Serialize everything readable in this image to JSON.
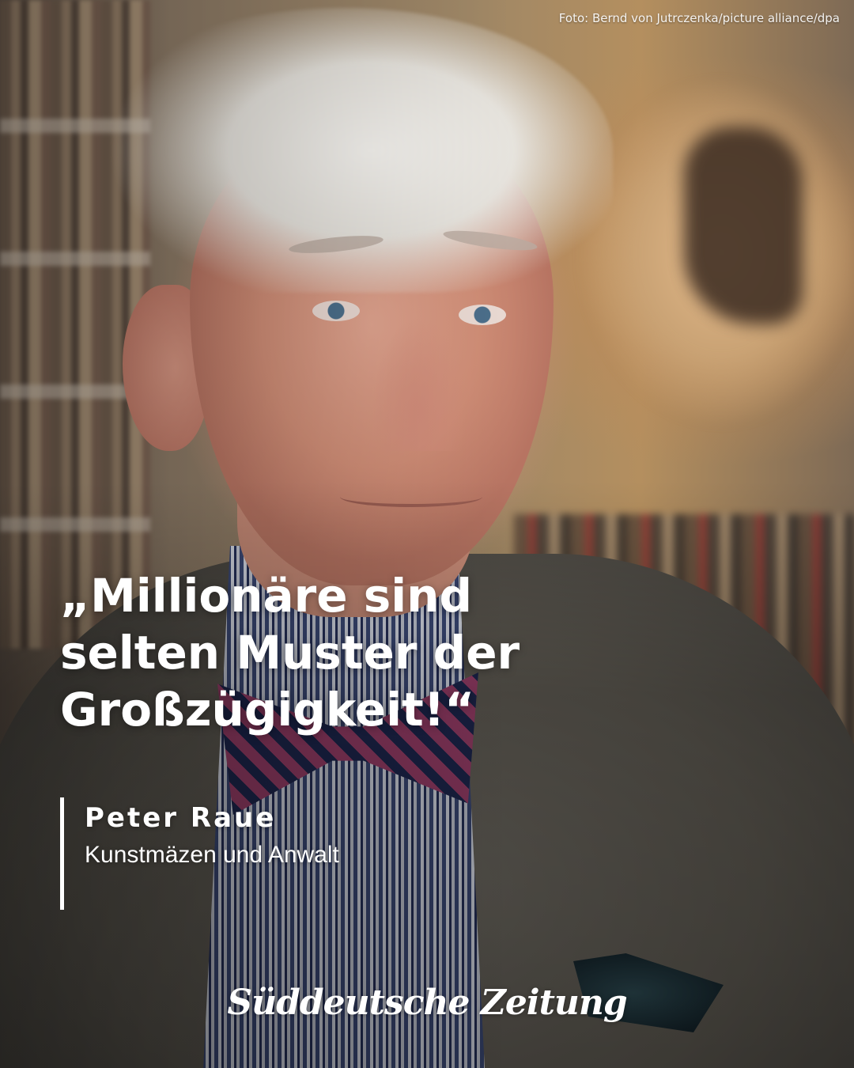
{
  "photo_credit": "Foto: Bernd von Jutrczenka/picture alliance/dpa",
  "quote": {
    "lines": [
      "„Millionäre sind",
      "selten Muster der",
      "Großzügigkeit!“"
    ]
  },
  "attribution": {
    "name": "Peter Raue",
    "role": "Kunstmäzen und Anwalt"
  },
  "logo": "Süddeutsche Zeitung",
  "colors": {
    "text": "#ffffff",
    "accent_bar": "#ffffff"
  }
}
